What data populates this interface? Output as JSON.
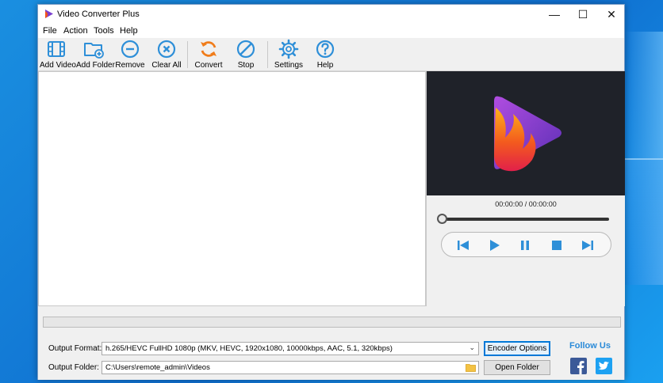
{
  "window": {
    "title": "Video Converter Plus",
    "controls": {
      "minimize": "—",
      "maximize": "☐",
      "close": "✕"
    }
  },
  "menu": [
    "File",
    "Action",
    "Tools",
    "Help"
  ],
  "toolbar": {
    "add_video": "Add Video",
    "add_folder": "Add Folder",
    "remove": "Remove",
    "clear_all": "Clear All",
    "convert": "Convert",
    "stop": "Stop",
    "settings": "Settings",
    "help": "Help"
  },
  "player": {
    "timecode": "00:00:00 / 00:00:00",
    "seek_progress": 0,
    "controls": [
      "previous-icon",
      "play-icon",
      "pause-icon",
      "stop-icon",
      "next-icon"
    ]
  },
  "conversion_progress": 0,
  "output": {
    "format_label": "Output Format:",
    "format_value": "h.265/HEVC FullHD 1080p (MKV, HEVC, 1920x1080, 10000kbps, AAC, 5.1, 320kbps)",
    "folder_label": "Output Folder:",
    "folder_value": "C:\\Users\\remote_admin\\Videos",
    "encoder_button": "Encoder Options",
    "open_folder_button": "Open Folder"
  },
  "follow": {
    "label": "Follow Us",
    "networks": [
      "facebook-icon",
      "twitter-icon"
    ]
  },
  "colors": {
    "accent_blue": "#2e8fd8",
    "convert_orange": "#f07c1a",
    "preview_bg": "#1f2229",
    "facebook": "#3b5998",
    "twitter": "#1da1f2"
  }
}
